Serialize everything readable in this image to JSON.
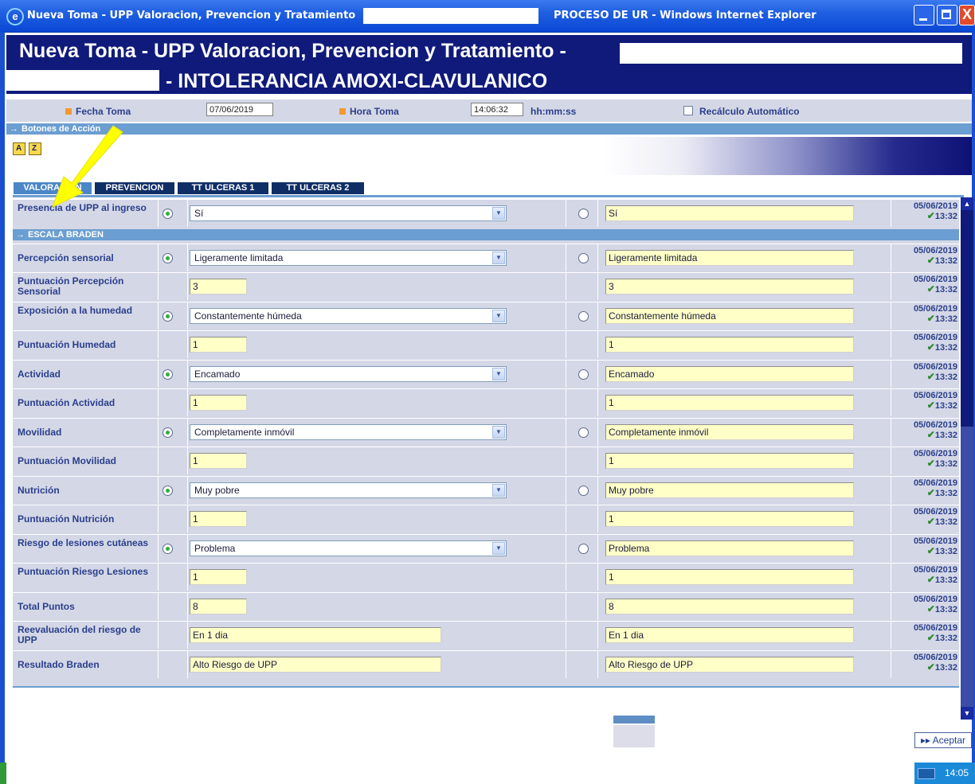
{
  "window": {
    "title_left": "Nueva Toma - UPP Valoracion, Prevencion y Tratamiento",
    "title_right": "PROCESO DE UR - Windows Internet Explorer",
    "close_glyph": "X",
    "ie_icon": "e"
  },
  "header": {
    "title": "Nueva Toma - UPP Valoracion, Prevencion y Tratamiento -",
    "subtitle": "- INTOLERANCIA AMOXI-CLAVULANICO"
  },
  "toma": {
    "fecha_label": "Fecha Toma",
    "fecha_value": "07/06/2019",
    "hora_label": "Hora Toma",
    "hora_value": "14:06:32",
    "hora_format": "hh:mm:ss",
    "recalculo_label": "Recálculo Automático"
  },
  "sections": {
    "botones": "Botones de Acción",
    "escala": "ESCALA BRADEN"
  },
  "tabs": [
    {
      "label": "VALORACION"
    },
    {
      "label": "PREVENCION"
    },
    {
      "label": "TT ULCERAS 1"
    },
    {
      "label": "TT ULCERAS 2"
    }
  ],
  "rows": [
    {
      "label": "Presencia de UPP al ingreso",
      "type": "select",
      "value": "Sí",
      "prev": "Sí",
      "date": "05/06/2019",
      "time": "13:32"
    },
    {
      "label": "Percepción sensorial",
      "type": "select",
      "value": "Ligeramente limitada",
      "prev": "Ligeramente limitada",
      "date": "05/06/2019",
      "time": "13:32"
    },
    {
      "label": "Puntuación Percepción Sensorial",
      "type": "score",
      "value": "3",
      "prev": "3",
      "date": "05/06/2019",
      "time": "13:32"
    },
    {
      "label": "Exposición a la humedad",
      "type": "select",
      "value": "Constantemente húmeda",
      "prev": "Constantemente húmeda",
      "date": "05/06/2019",
      "time": "13:32"
    },
    {
      "label": "Puntuación Humedad",
      "type": "score",
      "value": "1",
      "prev": "1",
      "date": "05/06/2019",
      "time": "13:32"
    },
    {
      "label": "Actividad",
      "type": "select",
      "value": "Encamado",
      "prev": "Encamado",
      "date": "05/06/2019",
      "time": "13:32"
    },
    {
      "label": "Puntuación Actividad",
      "type": "score",
      "value": "1",
      "prev": "1",
      "date": "05/06/2019",
      "time": "13:32"
    },
    {
      "label": "Movilidad",
      "type": "select",
      "value": "Completamente inmóvil",
      "prev": "Completamente inmóvil",
      "date": "05/06/2019",
      "time": "13:32"
    },
    {
      "label": "Puntuación Movilidad",
      "type": "score",
      "value": "1",
      "prev": "1",
      "date": "05/06/2019",
      "time": "13:32"
    },
    {
      "label": "Nutrición",
      "type": "select",
      "value": "Muy pobre",
      "prev": "Muy pobre",
      "date": "05/06/2019",
      "time": "13:32"
    },
    {
      "label": "Puntuación Nutrición",
      "type": "score",
      "value": "1",
      "prev": "1",
      "date": "05/06/2019",
      "time": "13:32"
    },
    {
      "label": "Riesgo de lesiones cutáneas",
      "type": "select",
      "value": "Problema",
      "prev": "Problema",
      "date": "05/06/2019",
      "time": "13:32"
    },
    {
      "label": "Puntuación Riesgo Lesiones",
      "type": "score",
      "value": "1",
      "prev": "1",
      "date": "05/06/2019",
      "time": "13:32"
    },
    {
      "label": "Total Puntos",
      "type": "score",
      "value": "8",
      "prev": "8",
      "date": "05/06/2019",
      "time": "13:32"
    },
    {
      "label": "Reevaluación del riesgo de UPP",
      "type": "text",
      "value": "En 1 dia",
      "prev": "En 1 dia",
      "date": "05/06/2019",
      "time": "13:32"
    },
    {
      "label": "Resultado Braden",
      "type": "text",
      "value": "Alto Riesgo de UPP",
      "prev": "Alto Riesgo de UPP",
      "date": "05/06/2019",
      "time": "13:32"
    }
  ],
  "footer": {
    "aceptar": "Aceptar",
    "aceptar_glyph": "▸▸",
    "clock": "14:05"
  },
  "colors": {
    "header_bg": "#0f1a7a",
    "section_bar": "#6b9ed1",
    "input_yellow": "#ffffc8",
    "label_text": "#2a3f8c",
    "check_green": "#2e8b2e",
    "radio_on": "#2fae3a"
  },
  "icons": {
    "ie": "internet-explorer-icon",
    "select": "dropdown-arrow-icon",
    "check": "check-icon"
  }
}
